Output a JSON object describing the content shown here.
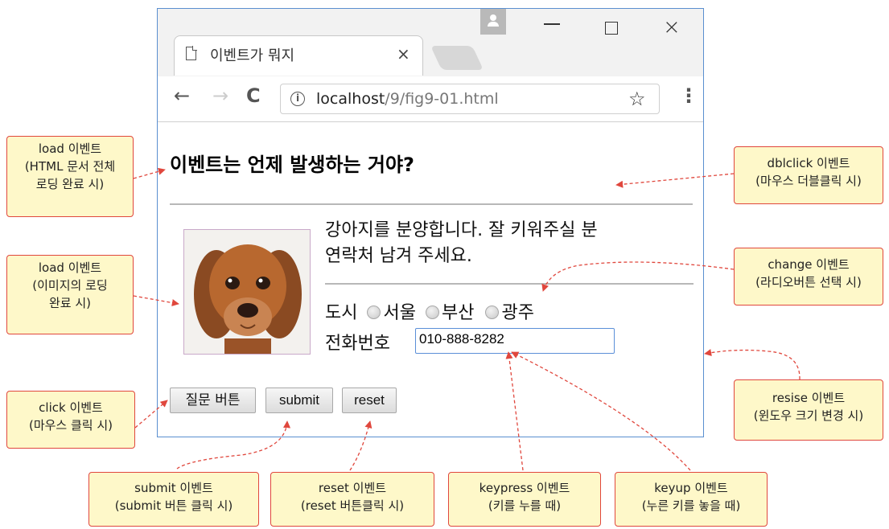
{
  "browser": {
    "tab_title": "이벤트가 뭐지",
    "tab_close": "×",
    "url_host": "localhost",
    "url_path": "/9/fig9-01.html",
    "nav_back": "←",
    "nav_forward": "→",
    "nav_reload": "C",
    "info": "i",
    "star": "☆",
    "menu": "⋮",
    "close": "×"
  },
  "page": {
    "heading": "이벤트는 언제 발생하는 거야?",
    "paragraph_line1": "강아지를 분양합니다. 잘 키워주실 분",
    "paragraph_line2": "연락처 남겨 주세요.",
    "city_label": "도시",
    "cities": [
      "서울",
      "부산",
      "광주"
    ],
    "phone_label": "전화번호",
    "phone_value": "010-888-8282",
    "buttons": {
      "question": "질문 버튼",
      "submit": "submit",
      "reset": "reset"
    }
  },
  "callouts": {
    "load_page": {
      "title": "load 이벤트",
      "desc_line1": "(HTML 문서 전체",
      "desc_line2": "로딩 완료 시)"
    },
    "load_image": {
      "title": "load 이벤트",
      "desc_line1": "(이미지의 로딩",
      "desc_line2": "완료 시)"
    },
    "click": {
      "title": "click 이벤트",
      "desc": "(마우스 클릭 시)"
    },
    "submit": {
      "title": "submit 이벤트",
      "desc": "(submit 버튼  클릭 시)"
    },
    "reset": {
      "title": "reset 이벤트",
      "desc": "(reset 버튼클릭 시)"
    },
    "keypress": {
      "title": "keypress 이벤트",
      "desc": "(키를 누를 때)"
    },
    "keyup": {
      "title": "keyup 이벤트",
      "desc": "(누른 키를 놓을 때)"
    },
    "dblclick": {
      "title": "dblclick 이벤트",
      "desc": "(마우스 더블클릭 시)"
    },
    "change": {
      "title": "change 이벤트",
      "desc": "(라디오버튼 선택 시)"
    },
    "resize": {
      "title": "resise 이벤트",
      "desc": "(윈도우 크기 변경 시)"
    }
  },
  "colors": {
    "callout_bg": "#fef8c9",
    "callout_border": "#e0473d",
    "arrow": "#e0473d",
    "window_border": "#5a8fd0"
  }
}
